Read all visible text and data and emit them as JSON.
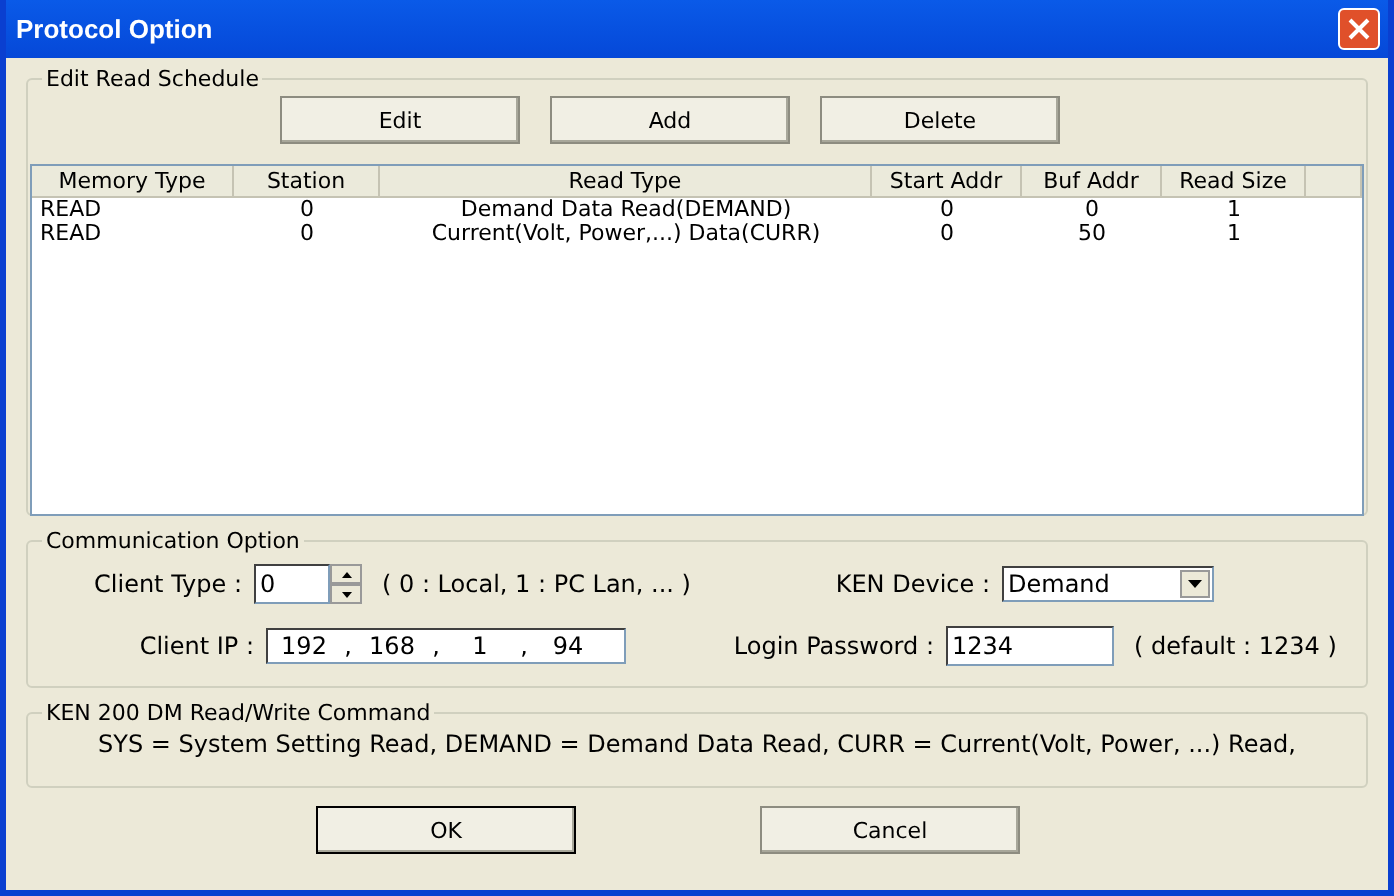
{
  "window": {
    "title": "Protocol Option"
  },
  "schedule": {
    "label": "Edit Read Schedule",
    "buttons": [
      "Edit",
      "Add",
      "Delete"
    ],
    "columns": [
      "Memory Type",
      "Station",
      "Read Type",
      "Start Addr",
      "Buf Addr",
      "Read Size"
    ],
    "rows": [
      {
        "cells": [
          "READ",
          "0",
          "Demand Data Read(DEMAND)",
          "0",
          "0",
          "1"
        ]
      },
      {
        "cells": [
          "READ",
          "0",
          "Current(Volt, Power,...) Data(CURR)",
          "0",
          "50",
          "1"
        ]
      }
    ]
  },
  "communication": {
    "label": "Communication Option",
    "client_type": {
      "label": "Client Type :",
      "value": "0",
      "hint": "( 0 : Local,  1 : PC Lan, ... )"
    },
    "client_ip": {
      "label": "Client IP :",
      "octets": [
        "192",
        "168",
        "1",
        "94"
      ],
      "separators": [
        ",",
        ",",
        ","
      ]
    },
    "ken_device": {
      "label": "KEN Device :",
      "value": "Demand"
    },
    "password": {
      "label": "Login Password :",
      "value": "1234",
      "hint": "( default : 1234 )"
    }
  },
  "command": {
    "label": "KEN 200 DM Read/Write Command",
    "text": "SYS = System Setting Read, DEMAND = Demand Data Read, CURR = Current(Volt, Power, ...) Read,"
  },
  "footer": {
    "buttons": [
      {
        "label": "OK",
        "default": true
      },
      {
        "label": "Cancel",
        "default": false
      }
    ]
  }
}
